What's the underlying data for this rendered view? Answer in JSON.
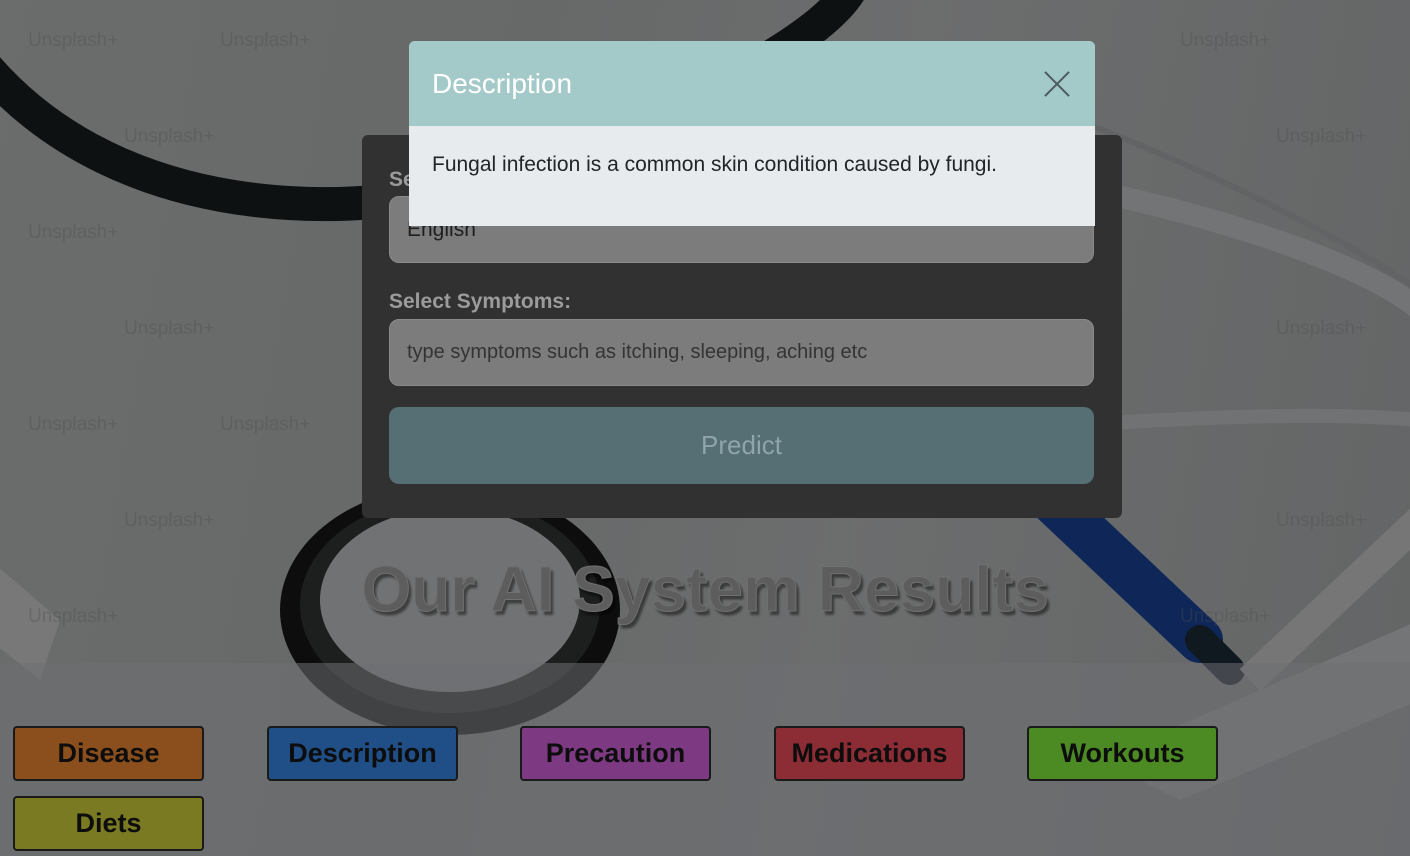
{
  "form": {
    "language_label": "Se",
    "language_value": "English",
    "symptoms_label": "Select Symptoms:",
    "symptoms_placeholder": "type symptoms such as itching, sleeping, aching etc",
    "predict_label": "Predict"
  },
  "headline": "Our AI System Results",
  "results_buttons": [
    {
      "label": "Disease",
      "color": "#8b4f1e"
    },
    {
      "label": "Description",
      "color": "#1f4f86"
    },
    {
      "label": "Precaution",
      "color": "#7d3a82"
    },
    {
      "label": "Medications",
      "color": "#8c2c35"
    },
    {
      "label": "Workouts",
      "color": "#4c8a24"
    },
    {
      "label": "Diets",
      "color": "#7a7a22"
    }
  ],
  "modal": {
    "title": "Description",
    "body": "Fungal infection is a common skin condition caused by fungi.",
    "close_icon": "close-icon"
  },
  "watermark_text": "Unsplash+",
  "colors": {
    "modal_header": "#a3c9c8",
    "predict_button": "#556f75",
    "card_background": "#313131"
  }
}
